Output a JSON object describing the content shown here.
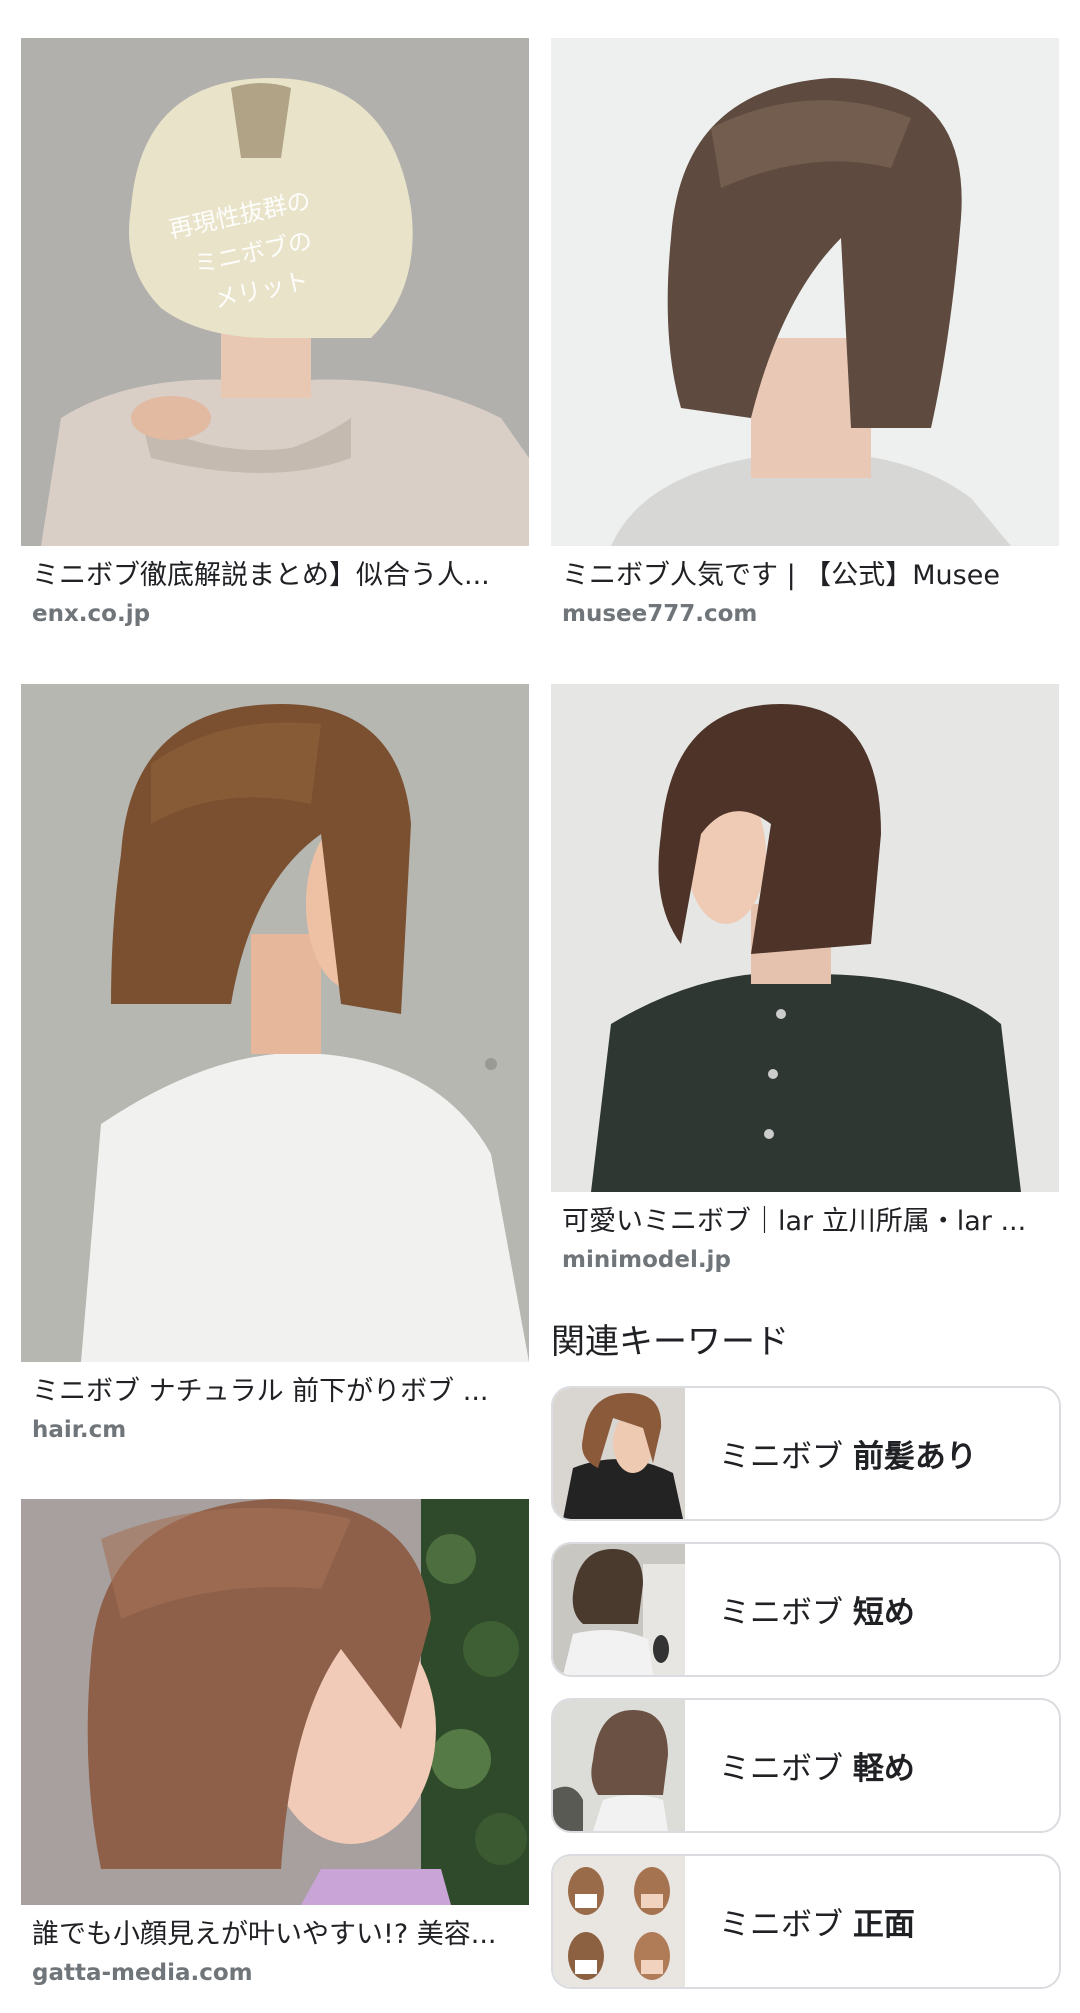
{
  "results": {
    "left": [
      {
        "title": "ミニボブ徹底解説まとめ】似合う人...",
        "source": "enx.co.jp",
        "image_overlay_lines": [
          "再現性抜群の",
          "ミニボブの",
          "メリット"
        ]
      },
      {
        "title": "ミニボブ ナチュラル 前下がりボブ ...",
        "source": "hair.cm"
      },
      {
        "title": "誰でも小顔見えが叶いやすい!? 美容...",
        "source": "gatta-media.com"
      }
    ],
    "right": [
      {
        "title": "ミニボブ人気です | 【公式】Musee",
        "source": "musee777.com"
      },
      {
        "title": "可愛いミニボブ｜lar 立川所属・lar ...",
        "source": "minimodel.jp"
      }
    ]
  },
  "related": {
    "heading": "関連キーワード",
    "items": [
      {
        "prefix": "ミニボブ ",
        "bold": "前髪あり"
      },
      {
        "prefix": "ミニボブ ",
        "bold": "短め"
      },
      {
        "prefix": "ミニボブ ",
        "bold": "軽め"
      },
      {
        "prefix": "ミニボブ ",
        "bold": "正面"
      }
    ]
  },
  "colors": {
    "source_text": "#70757a",
    "chip_border": "#dadce0",
    "title_text": "#202124"
  }
}
